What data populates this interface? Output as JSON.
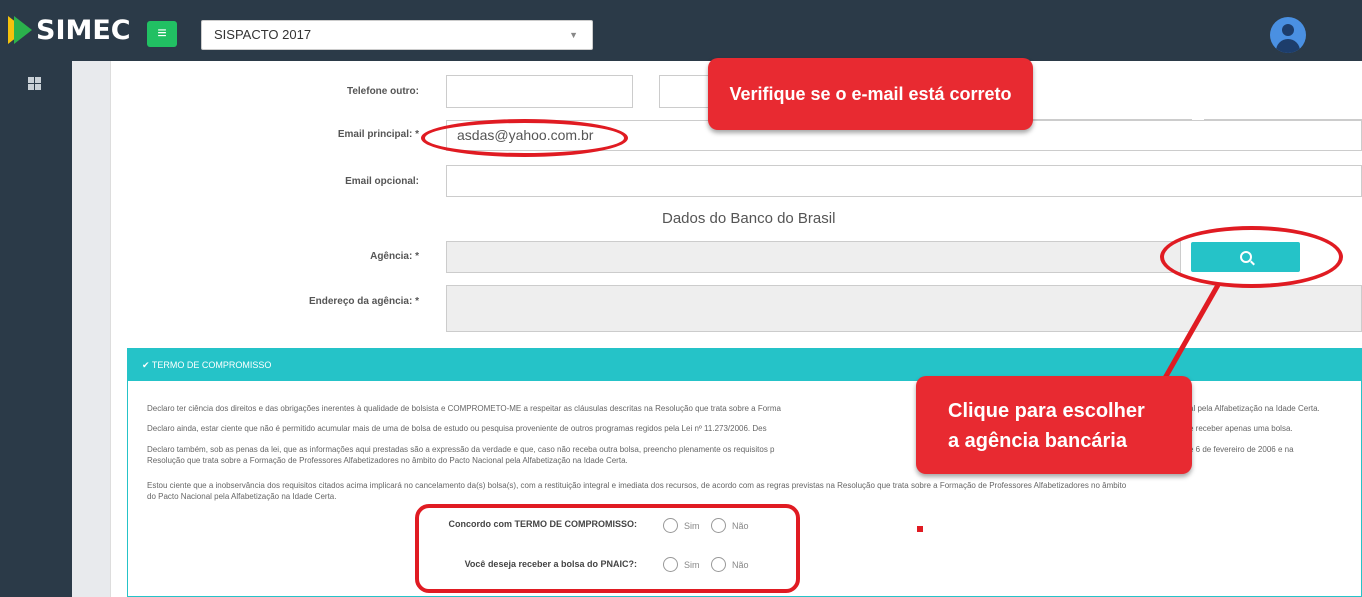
{
  "header": {
    "logo_text": "SIMEC",
    "menu_icon": "hamburger-icon",
    "system_selected": "SISPACTO 2017",
    "avatar_icon": "user-avatar-icon"
  },
  "sidebar": {
    "icon": "grid-icon"
  },
  "form": {
    "telefone_outro_label": "Telefone outro:",
    "email_principal_label": "Email principal: *",
    "email_principal_value": "asdas@yahoo.com.br",
    "email_opcional_label": "Email opcional:",
    "section_title": "Dados do Banco do Brasil",
    "agencia_label": "Agência: *",
    "endereco_label": "Endereço da agência: *",
    "search_icon": "zoom-in-icon"
  },
  "termo": {
    "title": "✔ TERMO DE COMPROMISSO",
    "paragraphs": [
      "Declaro ter ciência dos direitos e das obrigações inerentes à qualidade de bolsista e COMPROMETO-ME a respeitar as cláusulas descritas na Resolução que trata sobre a Forma",
      "al pela Alfabetização na Idade Certa.",
      "Declaro ainda, estar ciente que não é permitido acumular mais de uma de bolsa de estudo ou pesquisa proveniente de outros programas regidos pela Lei nº 11.273/2006. Des",
      "e receber apenas uma bolsa.",
      "Declaro também, sob as penas da lei, que as informações aqui prestadas são a expressão da verdade e que, caso não receba outra bolsa, preencho plenamente os requisitos p",
      "e 6 de fevereiro de 2006 e na",
      "Resolução que trata sobre a Formação de Professores Alfabetizadores no âmbito do Pacto Nacional pela Alfabetização na Idade Certa.",
      "Estou ciente que a inobservância dos requisitos citados acima implicará no cancelamento da(s) bolsa(s), com a restituição integral e imediata dos recursos, de acordo com as regras previstas na Resolução que trata sobre a Formação de Professores Alfabetizadores no âmbito",
      "do Pacto Nacional pela Alfabetização na Idade Certa."
    ],
    "q1_label": "Concordo com TERMO DE COMPROMISSO:",
    "q2_label": "Você deseja receber a bolsa do PNAIC?:",
    "sim": "Sim",
    "nao": "Não"
  },
  "annotations": {
    "callout_email": "Verifique se o e-mail está correto",
    "callout_agencia_1": "Clique para escolher",
    "callout_agencia_2": "a agência bancária",
    "color": "#e82a31"
  }
}
